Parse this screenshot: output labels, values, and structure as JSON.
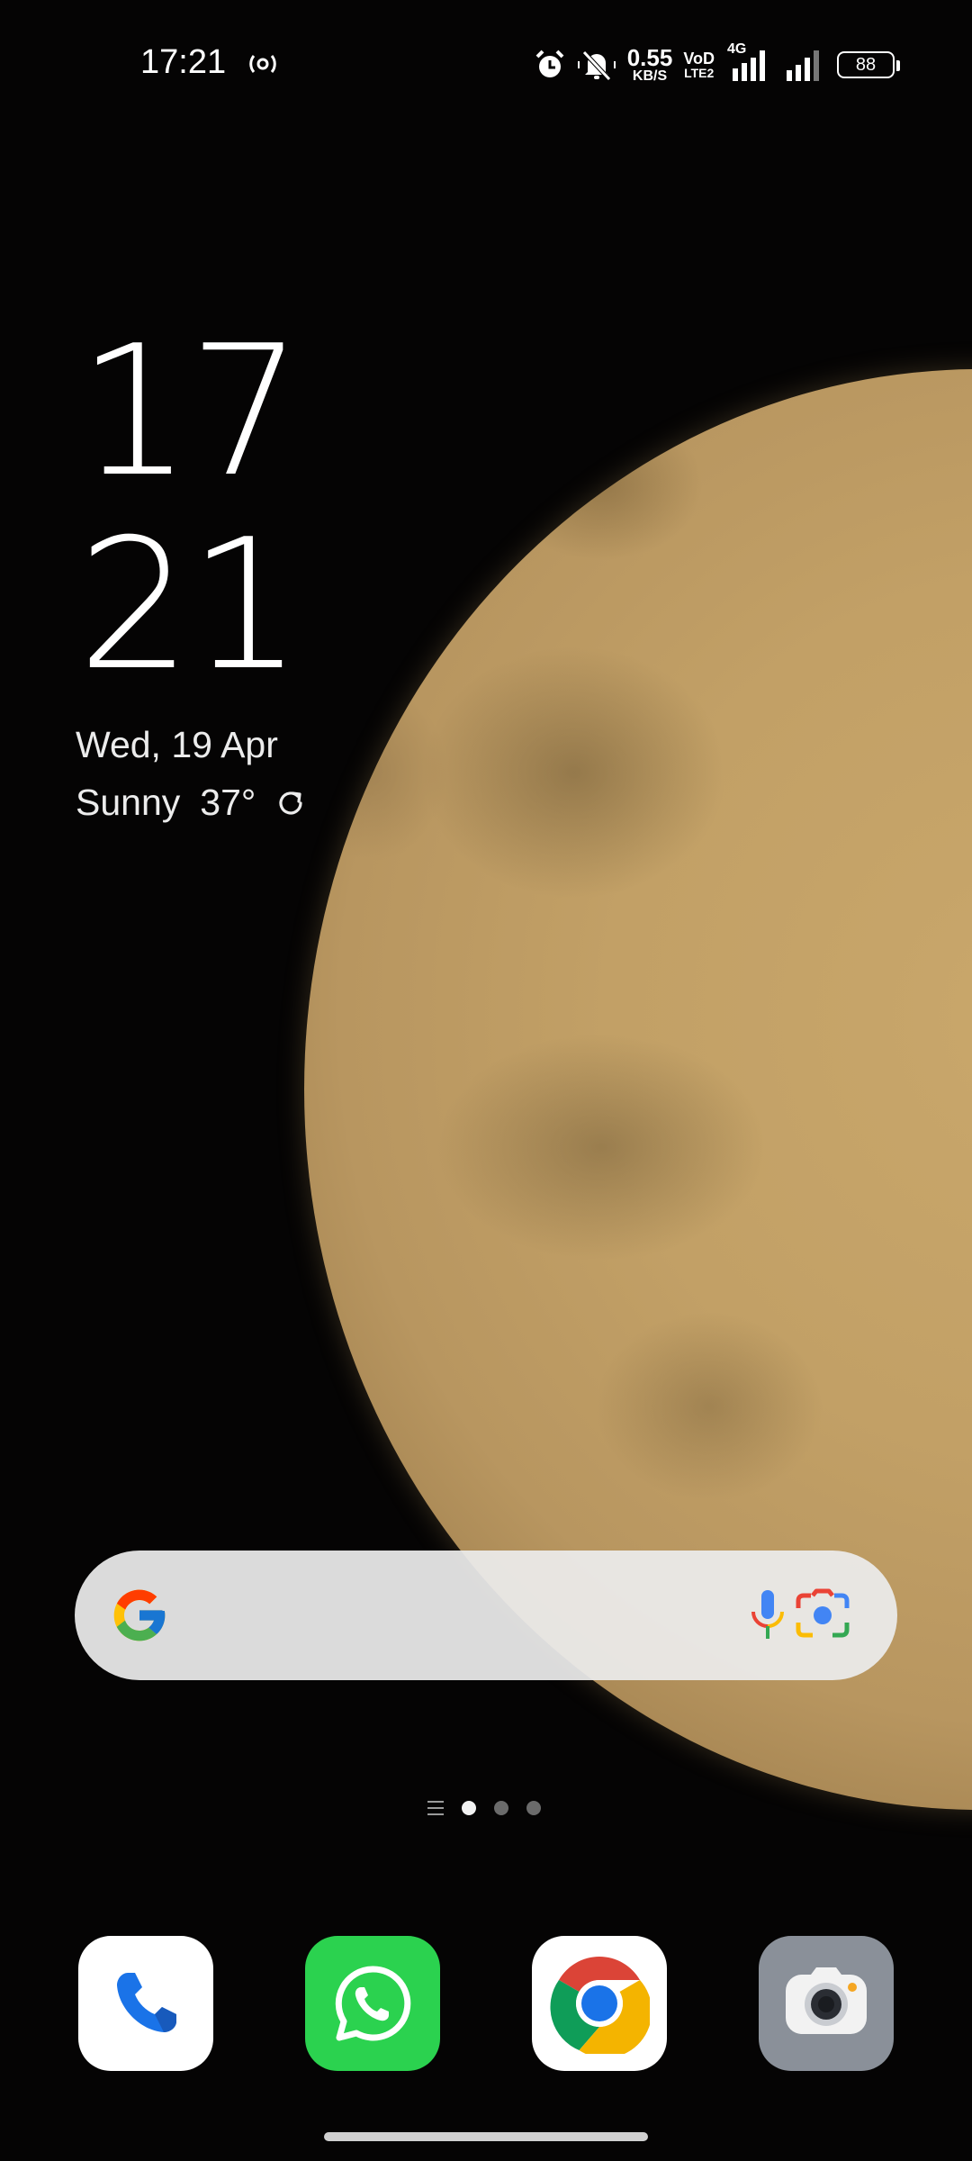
{
  "status_bar": {
    "time": "17:21",
    "net_speed_value": "0.55",
    "net_speed_unit": "KB/S",
    "volte_top": "VoD",
    "volte_bottom": "LTE2",
    "network_type": "4G",
    "battery_level": "88",
    "icons": [
      "hotspot-icon",
      "alarm-icon",
      "mute-icon",
      "signal-icon"
    ]
  },
  "clock_widget": {
    "hour": "17",
    "minute": "21",
    "date": "Wed, 19 Apr",
    "weather_condition": "Sunny",
    "temperature": "37°"
  },
  "search_widget": {
    "icons": [
      "google-logo-icon",
      "microphone-icon",
      "google-lens-icon"
    ]
  },
  "page_indicator": {
    "pages": 3,
    "active_page": 1
  },
  "dock": {
    "apps": [
      "phone",
      "whatsapp",
      "chrome",
      "camera"
    ]
  },
  "colors": {
    "whatsapp_green": "#2bd24f",
    "moon": "#c2a066",
    "background": "#050404"
  }
}
